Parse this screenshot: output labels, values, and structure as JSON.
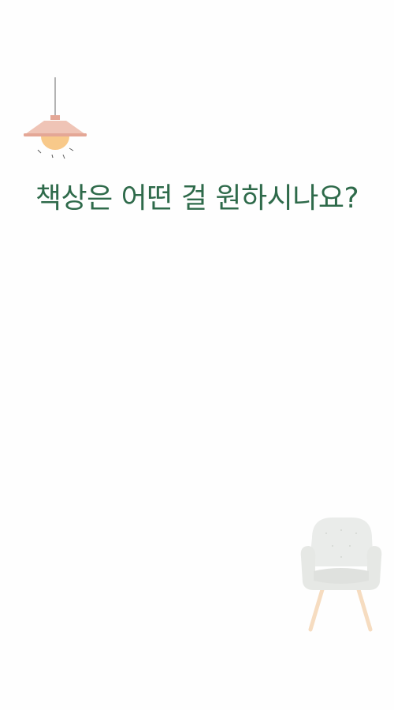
{
  "question": {
    "title": "책상은 어떤 걸 원하시나요?"
  },
  "decorations": {
    "lamp_icon": "pendant-lamp",
    "chair_icon": "armchair",
    "colors": {
      "title": "#2e6a4a",
      "lamp_shade": "#efc4b6",
      "lamp_bulb": "#f8c98a",
      "chair": "#e9ebe8",
      "chair_legs": "#f6dcc0"
    }
  }
}
